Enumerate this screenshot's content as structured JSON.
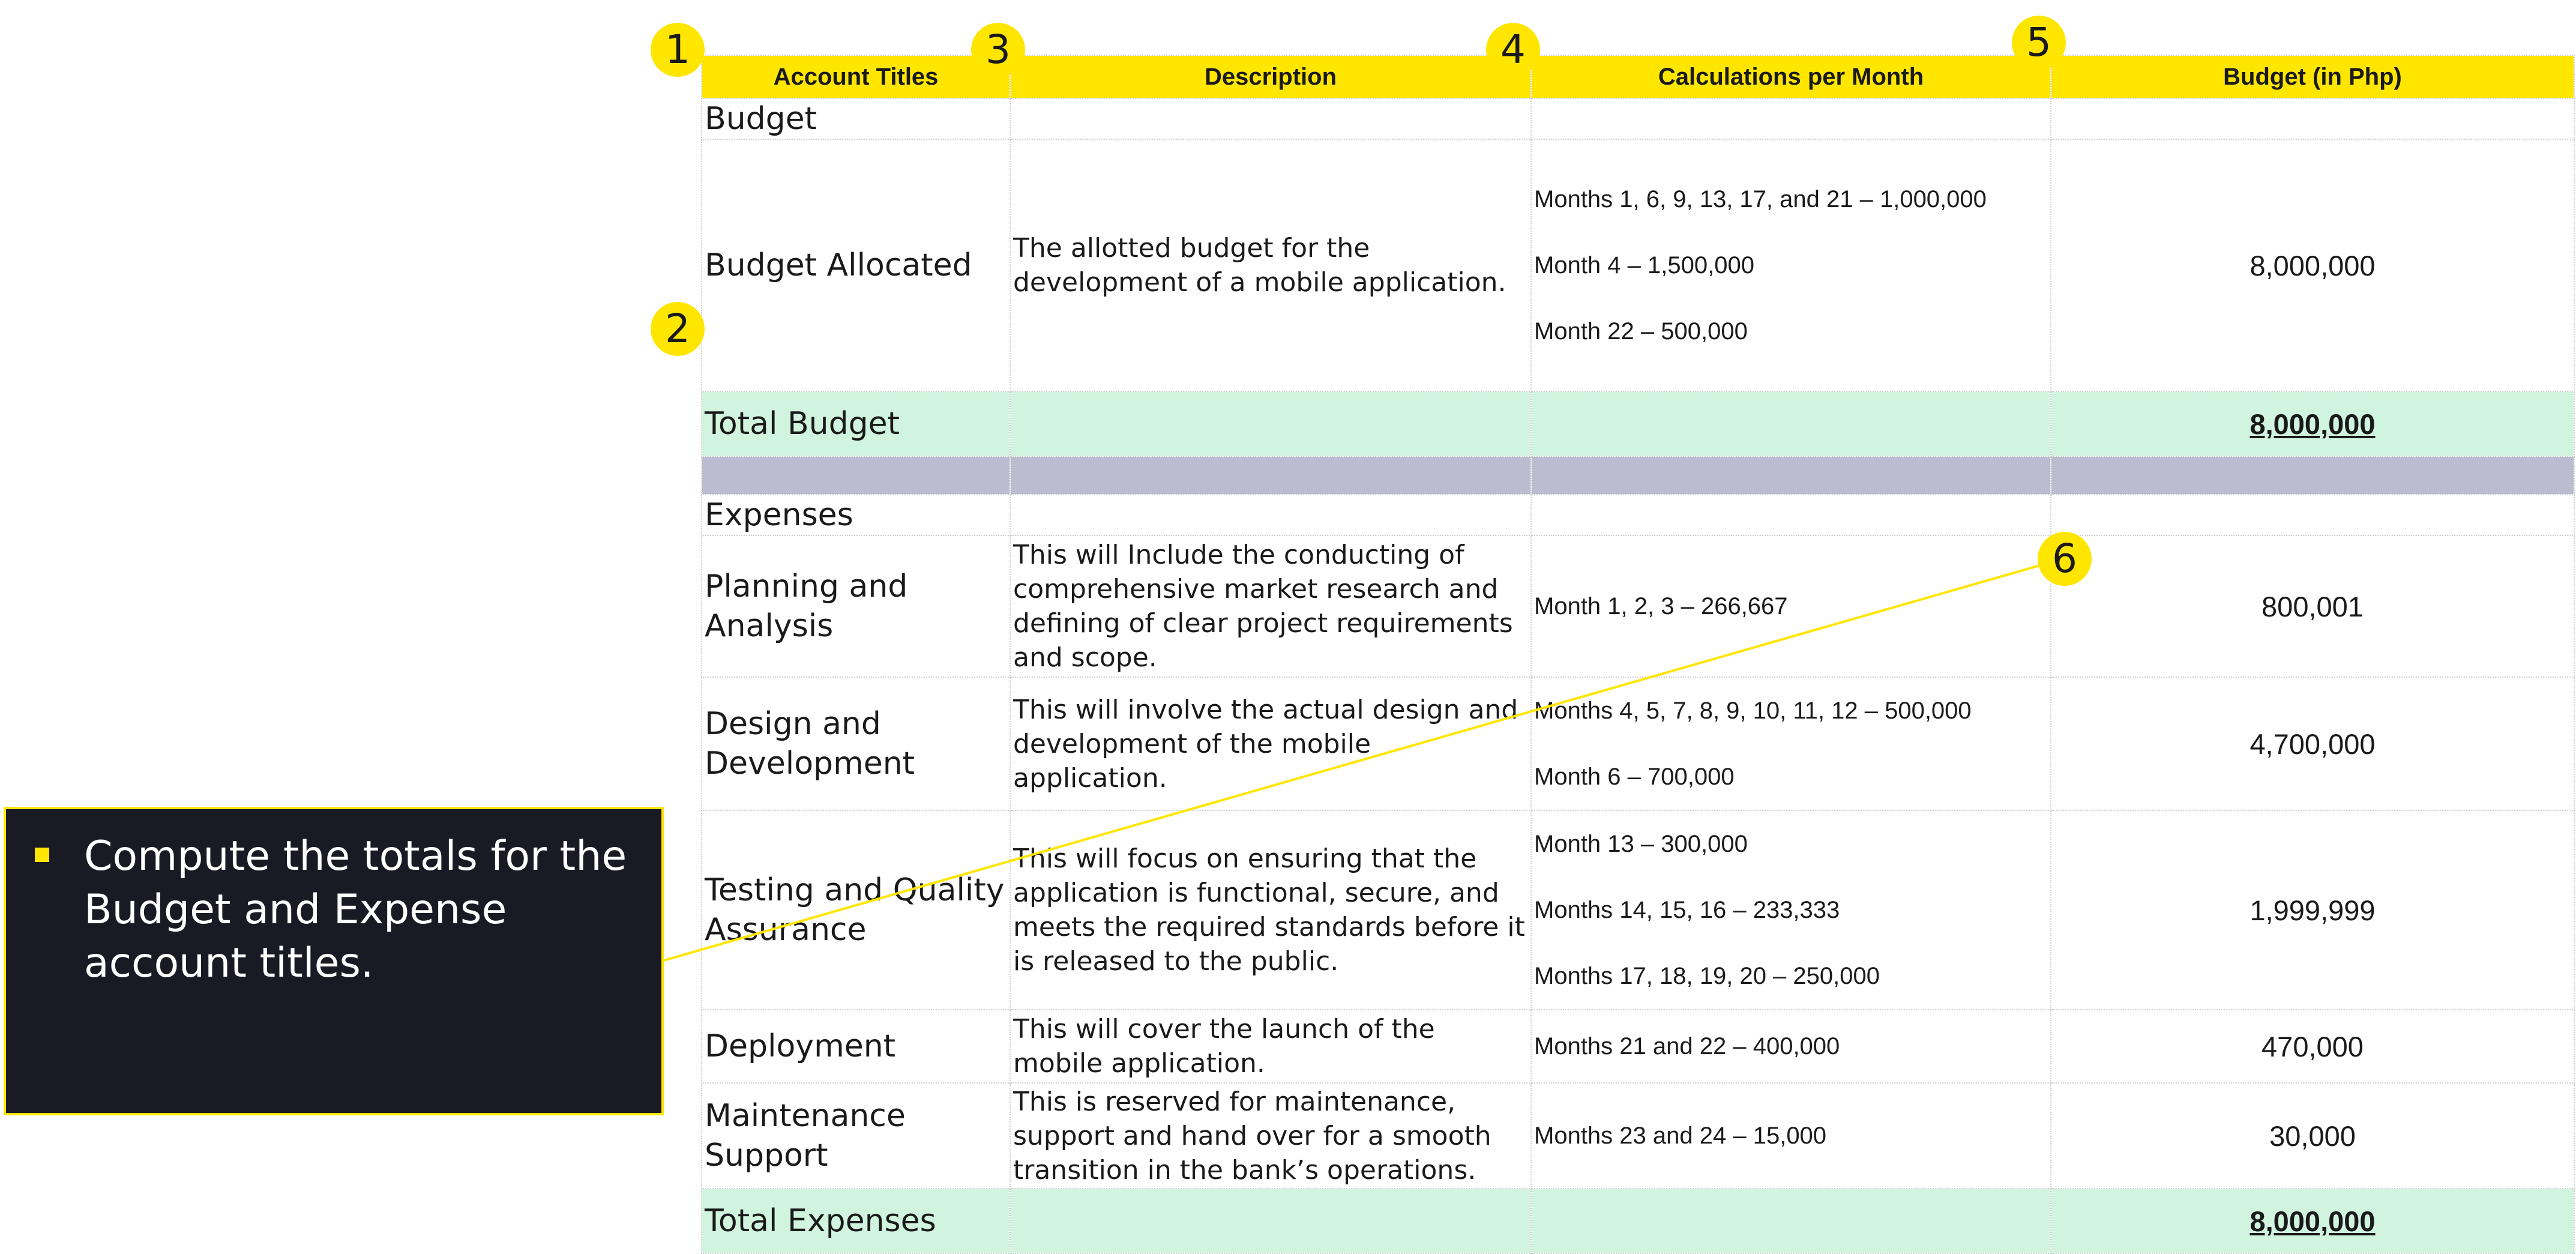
{
  "colors": {
    "accent": "#ffe600",
    "total_row": "#d1f4de",
    "separator_row": "#bdbbd0",
    "callout_bg": "#1a1a24"
  },
  "table": {
    "headers": [
      "Account Titles",
      "Description",
      "Calculations per Month",
      "Budget (in Php)"
    ],
    "budget_section": "Budget",
    "budget_allocated": {
      "title": "Budget Allocated",
      "description": "The allotted budget for the development of a mobile application.",
      "calculations": [
        "Months 1, 6, 9, 13, 17, and 21 – 1,000,000",
        "Month 4 – 1,500,000",
        "Month 22 – 500,000"
      ],
      "amount": "8,000,000"
    },
    "total_budget": {
      "label": "Total Budget",
      "amount": "8,000,000"
    },
    "expenses_section": "Expenses",
    "expenses": [
      {
        "title": "Planning and Analysis",
        "description": "This will Include the conducting of comprehensive market research and defining of clear project requirements and scope.",
        "calculations": [
          "Month 1, 2,  3 – 266,667"
        ],
        "amount": "800,001"
      },
      {
        "title": "Design and Development",
        "description": "This will involve the actual design and development of the mobile application.",
        "calculations": [
          "Months 4, 5, 7, 8, 9, 10, 11, 12 – 500,000",
          "Month 6 – 700,000"
        ],
        "amount": "4,700,000"
      },
      {
        "title": "Testing and Quality Assurance",
        "description": "This will focus on ensuring that the application is functional, secure, and meets the required standards before it is released to the public.",
        "calculations": [
          "Month 13 – 300,000",
          "Months 14, 15, 16 – 233,333",
          "Months 17, 18, 19, 20 – 250,000"
        ],
        "amount": "1,999,999"
      },
      {
        "title": "Deployment",
        "description": "This will cover the launch of the mobile application.",
        "calculations": [
          "Months 21 and 22 – 400,000"
        ],
        "amount": "470,000"
      },
      {
        "title": "Maintenance Support",
        "description": "This is reserved for maintenance, support and hand over for a smooth transition in the bank’s operations.",
        "calculations": [
          "Months 23 and 24 – 15,000"
        ],
        "amount": "30,000"
      }
    ],
    "total_expenses": {
      "label": "Total Expenses",
      "amount": "8,000,000"
    }
  },
  "markers": [
    "1",
    "2",
    "3",
    "4",
    "5",
    "6"
  ],
  "callout": {
    "text": "Compute the totals for the Budget and Expense account titles."
  }
}
